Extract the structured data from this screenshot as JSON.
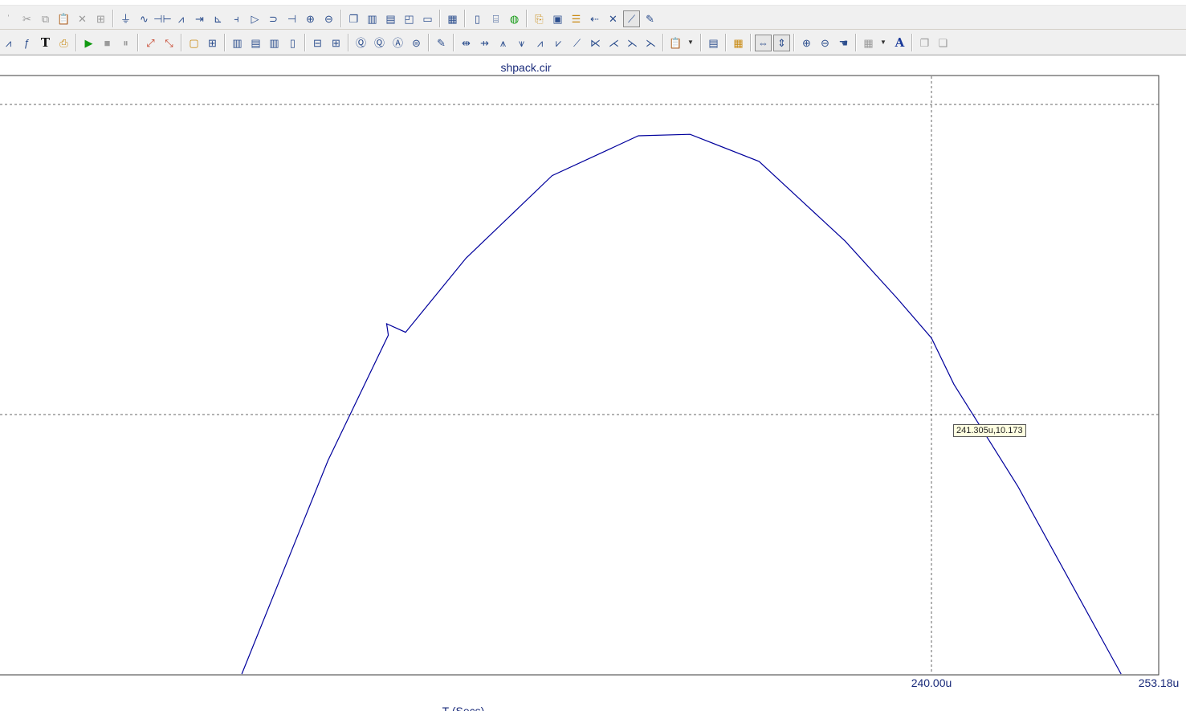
{
  "toolbar_top": {
    "items": [
      {
        "icon": "select-arrow-icon",
        "glyph": "ˈ",
        "tone": "gray"
      },
      {
        "icon": "cut-icon",
        "glyph": "✂",
        "tone": "gray"
      },
      {
        "icon": "copy-icon",
        "glyph": "⧉",
        "tone": "gray"
      },
      {
        "icon": "paste-icon",
        "glyph": "📋",
        "tone": "gray"
      },
      {
        "icon": "delete-icon",
        "glyph": "✕",
        "tone": "gray"
      },
      {
        "icon": "properties-icon",
        "glyph": "⊞",
        "tone": "gray"
      },
      {
        "sep": true
      },
      {
        "icon": "ground-icon",
        "glyph": "⏚"
      },
      {
        "icon": "wire-icon",
        "glyph": "∿"
      },
      {
        "icon": "capacitor-icon",
        "glyph": "⊣⊢"
      },
      {
        "icon": "resistor-icon",
        "glyph": "⩘"
      },
      {
        "icon": "diode-icon",
        "glyph": "⇥"
      },
      {
        "icon": "transistor-icon",
        "glyph": "⊾"
      },
      {
        "icon": "mosfet-icon",
        "glyph": "⫞"
      },
      {
        "icon": "opamp-icon",
        "glyph": "▷"
      },
      {
        "icon": "inductor-icon",
        "glyph": "⊃"
      },
      {
        "icon": "battery-icon",
        "glyph": "⊣"
      },
      {
        "icon": "voltage-source-icon",
        "glyph": "⊕"
      },
      {
        "icon": "current-source-icon",
        "glyph": "⊖"
      },
      {
        "sep": true
      },
      {
        "icon": "cascade-windows-icon",
        "glyph": "❐"
      },
      {
        "icon": "tile-vertical-icon",
        "glyph": "▥"
      },
      {
        "icon": "tile-horizontal-icon",
        "glyph": "▤"
      },
      {
        "icon": "arrange-icon",
        "glyph": "◰"
      },
      {
        "icon": "window-icon",
        "glyph": "▭"
      },
      {
        "sep": true
      },
      {
        "icon": "calculator-icon",
        "glyph": "▦"
      },
      {
        "sep": true
      },
      {
        "icon": "page-icon",
        "glyph": "▯"
      },
      {
        "icon": "component-browser-icon",
        "glyph": "⌸"
      },
      {
        "icon": "globe-icon",
        "glyph": "◍",
        "tone": "green"
      },
      {
        "sep": true
      },
      {
        "icon": "probe-icon",
        "glyph": "⎘",
        "tone": "gold"
      },
      {
        "icon": "monitor-icon",
        "glyph": "▣"
      },
      {
        "icon": "list-icon",
        "glyph": "☰",
        "tone": "gold"
      },
      {
        "icon": "node-icon",
        "glyph": "⇠"
      },
      {
        "icon": "tools-icon",
        "glyph": "✕"
      },
      {
        "icon": "plot-icon",
        "glyph": "⟋",
        "active": true
      },
      {
        "icon": "edit-plot-icon",
        "glyph": "✎"
      }
    ]
  },
  "toolbar_bottom": {
    "items": [
      {
        "icon": "scope-icon",
        "glyph": "⩘"
      },
      {
        "icon": "function-icon",
        "glyph": "ƒ"
      },
      {
        "icon": "text-icon",
        "glyph": "T",
        "tone": "bold"
      },
      {
        "icon": "plot-properties-icon",
        "glyph": "⎙",
        "tone": "gold"
      },
      {
        "sep": true
      },
      {
        "icon": "run-icon",
        "glyph": "▶",
        "tone": "green"
      },
      {
        "icon": "stop-icon",
        "glyph": "■",
        "tone": "gray"
      },
      {
        "icon": "pause-icon",
        "glyph": "⏸",
        "tone": "gray"
      },
      {
        "sep": true
      },
      {
        "icon": "scale-icon",
        "glyph": "⤢",
        "tone": "red"
      },
      {
        "icon": "auto-scale-icon",
        "glyph": "⤡",
        "tone": "red"
      },
      {
        "sep": true
      },
      {
        "icon": "rectangle-icon",
        "glyph": "▢",
        "tone": "gold"
      },
      {
        "icon": "grid-icon",
        "glyph": "⊞"
      },
      {
        "sep": true
      },
      {
        "icon": "grid-1-icon",
        "glyph": "▥"
      },
      {
        "icon": "grid-2-icon",
        "glyph": "▤"
      },
      {
        "icon": "grid-3-icon",
        "glyph": "▥"
      },
      {
        "icon": "grid-4-icon",
        "glyph": "▯"
      },
      {
        "sep": true
      },
      {
        "icon": "horizontal-icon",
        "glyph": "⊟"
      },
      {
        "icon": "crosshair-icon",
        "glyph": "⊞"
      },
      {
        "sep": true
      },
      {
        "icon": "zoom-icon",
        "glyph": "Ⓠ"
      },
      {
        "icon": "zoom-in-icon",
        "glyph": "Ⓠ"
      },
      {
        "icon": "zoom-out-icon",
        "glyph": "Ⓐ"
      },
      {
        "icon": "zoom-fit-icon",
        "glyph": "⊜"
      },
      {
        "sep": true
      },
      {
        "icon": "edit-icon",
        "glyph": "✎"
      },
      {
        "sep": true
      },
      {
        "icon": "cursor-next-icon",
        "glyph": "⇹"
      },
      {
        "icon": "cursor-prev-icon",
        "glyph": "⇸"
      },
      {
        "icon": "peak-icon",
        "glyph": "⩚"
      },
      {
        "icon": "valley-icon",
        "glyph": "⩛"
      },
      {
        "icon": "high-icon",
        "glyph": "⩘"
      },
      {
        "icon": "low-icon",
        "glyph": "⩗"
      },
      {
        "icon": "inflection-icon",
        "glyph": "⟋"
      },
      {
        "icon": "slope-icon",
        "glyph": "⋉"
      },
      {
        "icon": "global-high-icon",
        "glyph": "⋌"
      },
      {
        "icon": "global-low-icon",
        "glyph": "⋋"
      },
      {
        "icon": "bottom-icon",
        "glyph": "⋋"
      },
      {
        "sep": true
      },
      {
        "icon": "clipboard-icon",
        "glyph": "📋",
        "tone": "gold"
      },
      {
        "icon": "dropdown-icon",
        "glyph": "▼",
        "dd": true
      },
      {
        "sep": true
      },
      {
        "icon": "data-table-icon",
        "glyph": "▤"
      },
      {
        "sep": true
      },
      {
        "icon": "numeric-icon",
        "glyph": "▦",
        "tone": "gold"
      },
      {
        "sep": true
      },
      {
        "icon": "fit-width-icon",
        "glyph": "⇔",
        "active": true
      },
      {
        "icon": "fit-height-icon",
        "glyph": "⇕",
        "active": true
      },
      {
        "sep": true
      },
      {
        "icon": "magnify-plus-icon",
        "glyph": "⊕"
      },
      {
        "icon": "magnify-minus-icon",
        "glyph": "⊖"
      },
      {
        "icon": "pan-icon",
        "glyph": "☚"
      },
      {
        "sep": true
      },
      {
        "icon": "layout-icon",
        "glyph": "▦",
        "tone": "gray"
      },
      {
        "icon": "layout-dropdown-icon",
        "glyph": "▼",
        "dd": true
      },
      {
        "icon": "font-icon",
        "glyph": "A",
        "tone": "navy"
      },
      {
        "sep": true
      },
      {
        "icon": "bring-front-icon",
        "glyph": "❐",
        "tone": "gray"
      },
      {
        "icon": "send-back-icon",
        "glyph": "❏",
        "tone": "gray"
      }
    ]
  },
  "plot": {
    "title": "shpack.cir",
    "cursor_readout": "241.305u,10.173",
    "x_axis_title": "T (Secs)"
  },
  "chart_data": {
    "type": "line",
    "title": "shpack.cir",
    "xlabel": "T (Secs)",
    "ylabel": "",
    "x_unit": "u",
    "xlim": [
      200.0,
      253.18
    ],
    "x_tick_labels": [
      "240.00u",
      "253.18u"
    ],
    "x_ticks": [
      240.0,
      253.18
    ],
    "grid": true,
    "line_color": "#00009c",
    "ylim": [
      0,
      20
    ],
    "series": [
      {
        "x": [
          200.0,
          205.0,
          208.5,
          208.4,
          209.5,
          213.0,
          218.0,
          223.0,
          226.0,
          230.0,
          235.0,
          238.0,
          240.0,
          241.305,
          245.0,
          250.0,
          251.0
        ],
        "y": [
          0.0,
          7.5,
          11.9,
          12.3,
          12.0,
          14.6,
          17.5,
          18.9,
          18.95,
          18.0,
          15.2,
          13.2,
          11.8,
          10.173,
          6.6,
          1.1,
          0.0
        ]
      }
    ],
    "cursor": {
      "x": 241.305,
      "y": 10.173,
      "vertical_at": 240.0
    }
  }
}
